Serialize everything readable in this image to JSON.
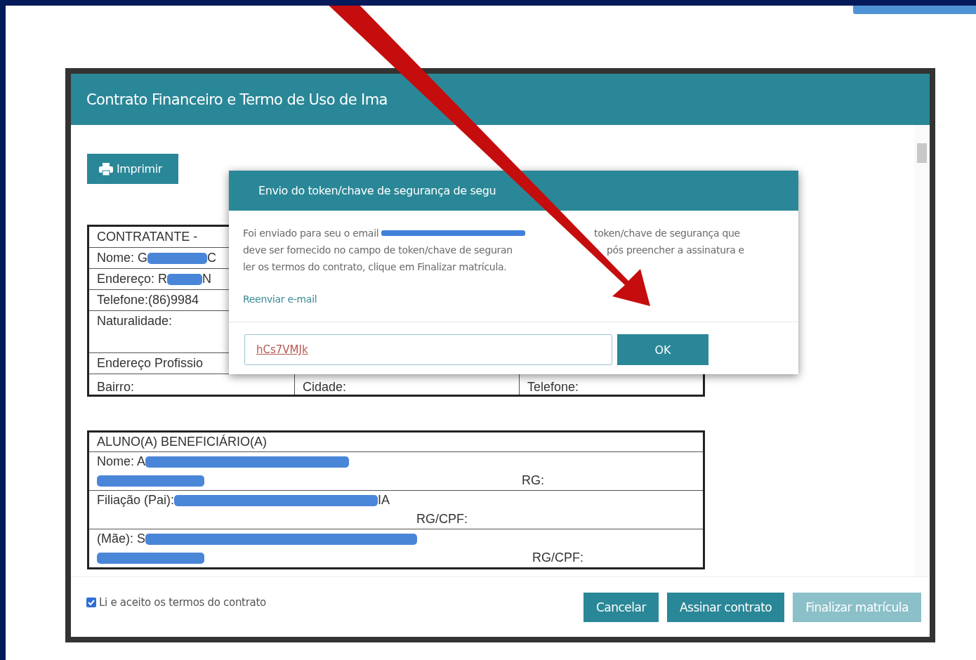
{
  "dialog": {
    "title": "Contrato Financeiro e Termo de Uso de Ima",
    "print_button": "Imprimir",
    "contractor_table": [
      {
        "lines": [
          [
            {
              "kind": "text",
              "text": "CONTRATANTE -"
            }
          ]
        ]
      },
      {
        "lines": [
          [
            {
              "kind": "text",
              "text": "Nome: G"
            },
            {
              "kind": "redaction"
            },
            {
              "kind": "text",
              "text": "C"
            }
          ]
        ]
      },
      {
        "lines": [
          [
            {
              "kind": "text",
              "text": "Endereço: R"
            },
            {
              "kind": "redaction"
            },
            {
              "kind": "text",
              "text": "N"
            }
          ]
        ]
      },
      {
        "lines": [
          [
            {
              "kind": "text",
              "text": "Telefone:(86)9984"
            }
          ]
        ]
      },
      {
        "lines": [
          [
            {
              "kind": "text",
              "text": "Naturalidade:"
            }
          ]
        ]
      },
      {
        "lines": [
          [
            {
              "kind": "text",
              "text": "Endereço Profissio"
            }
          ]
        ]
      },
      {
        "cells": [
          "Bairro:",
          "Cidade:",
          "Telefone:"
        ]
      }
    ],
    "student_table": [
      {
        "lines": [
          [
            {
              "kind": "text",
              "text": "ALUNO(A) BENEFICIÁRIO(A)"
            }
          ]
        ]
      },
      {
        "lines": [
          [
            {
              "kind": "text",
              "text": "Nome: A"
            },
            {
              "kind": "redaction"
            }
          ],
          [
            {
              "kind": "redaction"
            },
            {
              "kind": "aside",
              "text": "RG:"
            }
          ]
        ]
      },
      {
        "lines": [
          [
            {
              "kind": "text",
              "text": "Filiação (Pai):"
            },
            {
              "kind": "redaction"
            },
            {
              "kind": "text",
              "text": "IA"
            }
          ],
          [
            {
              "kind": "aside",
              "text": "RG/CPF:"
            }
          ]
        ]
      },
      {
        "lines": [
          [
            {
              "kind": "text",
              "text": "(Mãe): S"
            },
            {
              "kind": "redaction"
            }
          ],
          [
            {
              "kind": "redaction"
            },
            {
              "kind": "aside",
              "text": "RG/CPF:"
            }
          ]
        ]
      }
    ],
    "accept_terms": {
      "label": "Li e aceito os termos do contrato",
      "checked": true
    },
    "buttons": [
      {
        "label": "Cancelar",
        "disabled": false
      },
      {
        "label": "Assinar contrato",
        "disabled": false
      },
      {
        "label": "Finalizar matrícula",
        "disabled": true
      }
    ]
  },
  "token_dialog": {
    "title": "Envio do token/chave de segurança de segu",
    "message": [
      [
        [
          {
            "kind": "text",
            "text": "Foi enviado para seu o email"
          },
          {
            "kind": "redaction"
          }
        ],
        [
          {
            "kind": "text",
            "text": "token/chave de segurança que"
          }
        ]
      ],
      [
        [
          {
            "kind": "text",
            "text": "deve ser fornecido no campo de token/chave de seguran"
          }
        ],
        [
          {
            "kind": "text",
            "text": "pós preencher a assinatura e"
          }
        ]
      ],
      [
        [
          {
            "kind": "text",
            "text": "ler os termos do contrato, clique em Finalizar matrícula."
          }
        ]
      ]
    ],
    "resend_link": "Reenviar e-mail",
    "token_value": "hCs7VMJk",
    "ok_button": "OK"
  }
}
